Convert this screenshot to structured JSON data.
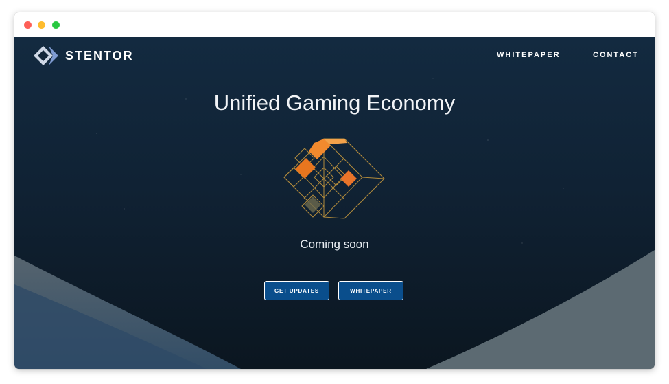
{
  "window": {
    "controls": [
      "close",
      "minimize",
      "maximize"
    ]
  },
  "header": {
    "brand": "STENTOR",
    "nav": {
      "whitepaper": "WHITEPAPER",
      "contact": "CONTACT"
    }
  },
  "hero": {
    "title": "Unified Gaming Economy",
    "tagline": "Coming soon",
    "buttons": {
      "get_updates": "GET UPDATES",
      "whitepaper": "WHITEPAPER"
    }
  },
  "colors": {
    "background_dark": "#102234",
    "button_fill": "#0a4e8c",
    "accent_orange": "#f28a2e",
    "emblem_gold": "#b08a3c"
  }
}
